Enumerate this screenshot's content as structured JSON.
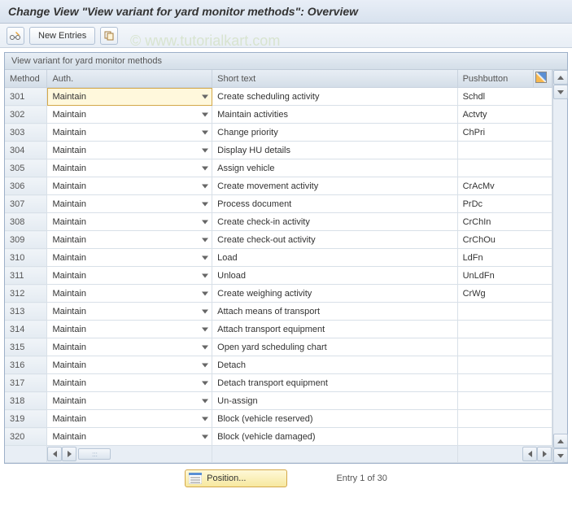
{
  "title": "Change View \"View variant for yard monitor methods\": Overview",
  "toolbar": {
    "new_entries_label": "New Entries"
  },
  "watermark": "© www.tutorialkart.com",
  "table": {
    "title": "View variant for yard monitor methods",
    "headers": {
      "method": "Method",
      "auth": "Auth.",
      "short_text": "Short text",
      "pushbutton": "Pushbutton"
    },
    "rows": [
      {
        "method": "301",
        "auth": "Maintain",
        "short_text": "Create scheduling activity",
        "pushbutton": "Schdl"
      },
      {
        "method": "302",
        "auth": "Maintain",
        "short_text": "Maintain activities",
        "pushbutton": "Actvty"
      },
      {
        "method": "303",
        "auth": "Maintain",
        "short_text": "Change priority",
        "pushbutton": "ChPri"
      },
      {
        "method": "304",
        "auth": "Maintain",
        "short_text": "Display HU details",
        "pushbutton": ""
      },
      {
        "method": "305",
        "auth": "Maintain",
        "short_text": "Assign vehicle",
        "pushbutton": ""
      },
      {
        "method": "306",
        "auth": "Maintain",
        "short_text": "Create movement activity",
        "pushbutton": "CrAcMv"
      },
      {
        "method": "307",
        "auth": "Maintain",
        "short_text": "Process document",
        "pushbutton": "PrDc"
      },
      {
        "method": "308",
        "auth": "Maintain",
        "short_text": "Create check-in activity",
        "pushbutton": "CrChIn"
      },
      {
        "method": "309",
        "auth": "Maintain",
        "short_text": "Create check-out activity",
        "pushbutton": "CrChOu"
      },
      {
        "method": "310",
        "auth": "Maintain",
        "short_text": "Load",
        "pushbutton": "LdFn"
      },
      {
        "method": "311",
        "auth": "Maintain",
        "short_text": "Unload",
        "pushbutton": "UnLdFn"
      },
      {
        "method": "312",
        "auth": "Maintain",
        "short_text": "Create weighing activity",
        "pushbutton": "CrWg"
      },
      {
        "method": "313",
        "auth": "Maintain",
        "short_text": "Attach means of transport",
        "pushbutton": ""
      },
      {
        "method": "314",
        "auth": "Maintain",
        "short_text": "Attach transport equipment",
        "pushbutton": ""
      },
      {
        "method": "315",
        "auth": "Maintain",
        "short_text": "Open yard scheduling chart",
        "pushbutton": ""
      },
      {
        "method": "316",
        "auth": "Maintain",
        "short_text": "Detach",
        "pushbutton": ""
      },
      {
        "method": "317",
        "auth": "Maintain",
        "short_text": "Detach transport equipment",
        "pushbutton": ""
      },
      {
        "method": "318",
        "auth": "Maintain",
        "short_text": "Un-assign",
        "pushbutton": ""
      },
      {
        "method": "319",
        "auth": "Maintain",
        "short_text": "Block (vehicle reserved)",
        "pushbutton": ""
      },
      {
        "method": "320",
        "auth": "Maintain",
        "short_text": "Block (vehicle damaged)",
        "pushbutton": ""
      }
    ]
  },
  "bottom": {
    "position_label": "Position...",
    "entry_status": "Entry 1 of 30"
  }
}
